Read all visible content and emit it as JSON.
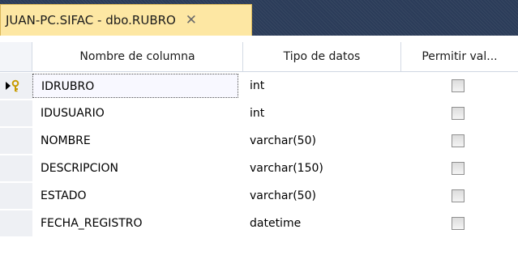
{
  "tab": {
    "title": "JUAN-PC.SIFAC - dbo.RUBRO",
    "close_label": "✕"
  },
  "columns": {
    "name": "Nombre de columna",
    "type": "Tipo de datos",
    "allow_null": "Permitir val..."
  },
  "rows": [
    {
      "name": "IDRUBRO",
      "type": "int",
      "allow_null": false,
      "primary_key": true,
      "current": true
    },
    {
      "name": "IDUSUARIO",
      "type": "int",
      "allow_null": false
    },
    {
      "name": "NOMBRE",
      "type": "varchar(50)",
      "allow_null": false
    },
    {
      "name": "DESCRIPCION",
      "type": "varchar(150)",
      "allow_null": false
    },
    {
      "name": "ESTADO",
      "type": "varchar(50)",
      "allow_null": false
    },
    {
      "name": "FECHA_REGISTRO",
      "type": "datetime",
      "allow_null": false
    }
  ],
  "colors": {
    "tabstrip_bg": "#2b3c59",
    "active_tab_bg": "#fde7a3",
    "key_icon": "#d4a800",
    "row_selector_bg": "#eef0f4"
  }
}
